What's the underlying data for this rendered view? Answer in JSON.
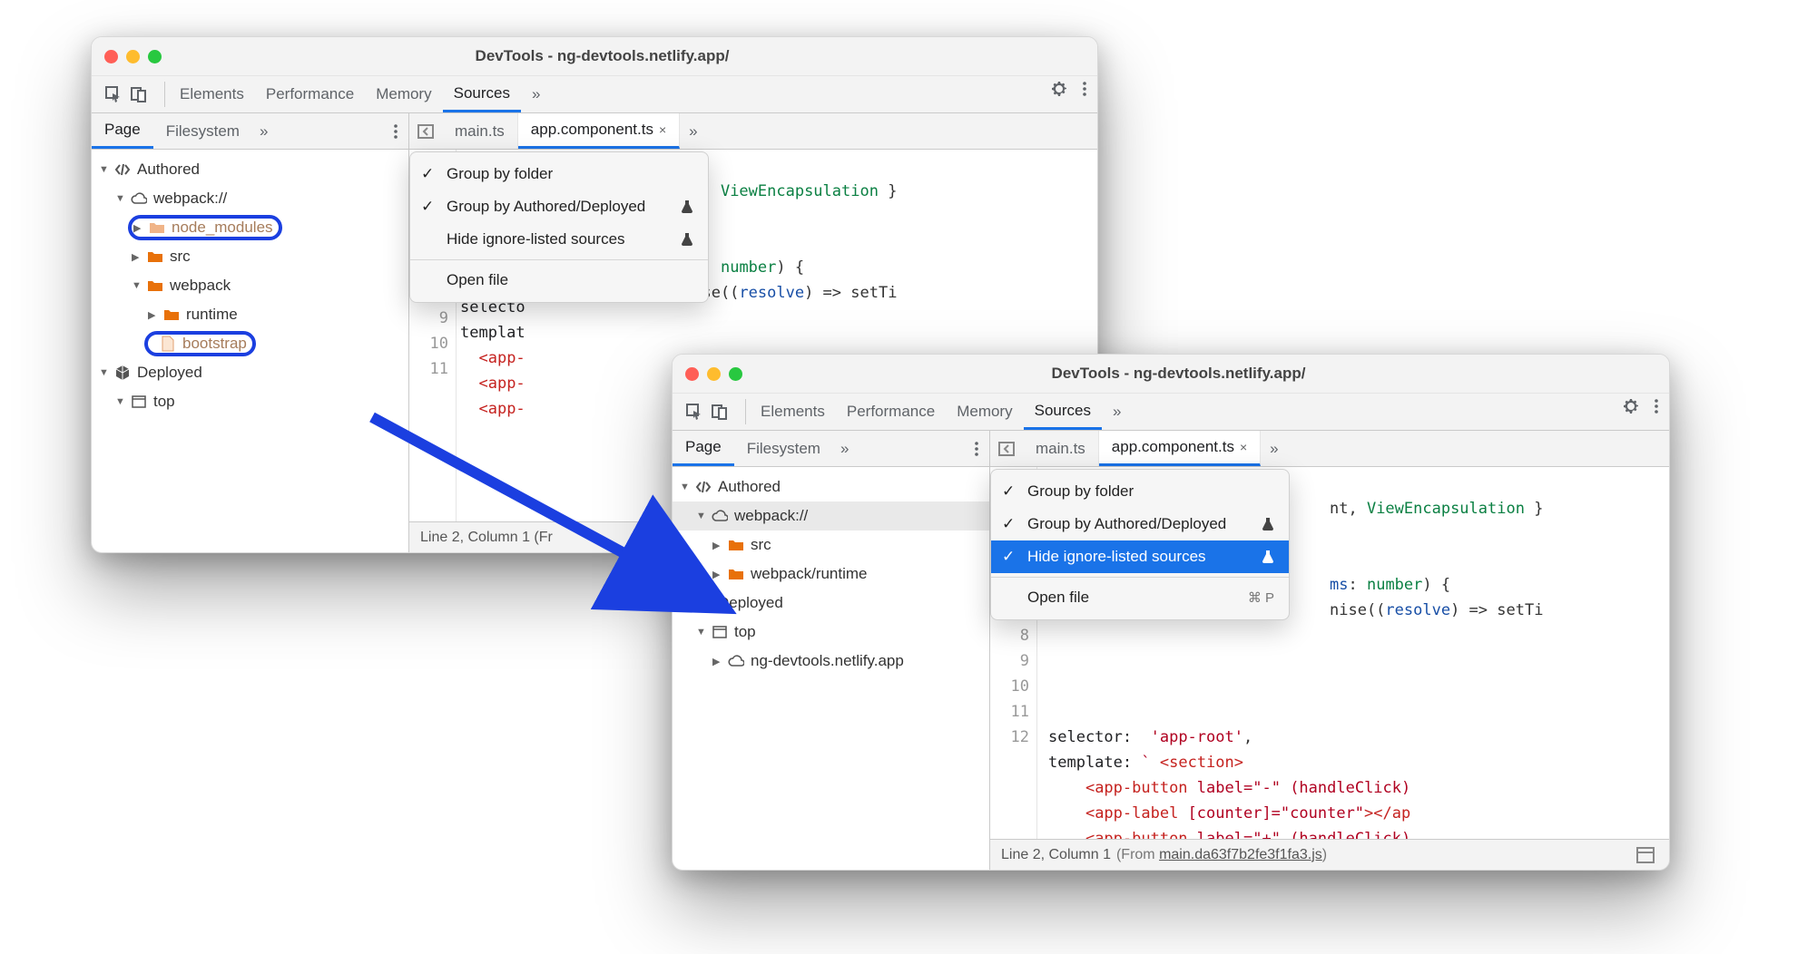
{
  "window_title": "DevTools - ng-devtools.netlify.app/",
  "toolbar": {
    "panels": [
      "Elements",
      "Performance",
      "Memory",
      "Sources"
    ],
    "active_panel": "Sources",
    "overflow": "»"
  },
  "subbar": {
    "nav_tabs": [
      "Page",
      "Filesystem"
    ],
    "active_nav": "Page",
    "nav_overflow": "»",
    "file_tabs": [
      {
        "label": "main.ts",
        "closeable": false
      },
      {
        "label": "app.component.ts",
        "closeable": true
      }
    ],
    "active_file_tab": "app.component.ts",
    "file_overflow": "»"
  },
  "tree_back": {
    "authored": "Authored",
    "webpack": "webpack://",
    "node_modules": "node_modules",
    "src": "src",
    "webpack_folder": "webpack",
    "runtime": "runtime",
    "bootstrap": "bootstrap",
    "deployed": "Deployed",
    "top": "top"
  },
  "tree_front": {
    "authored": "Authored",
    "webpack": "webpack://",
    "src": "src",
    "webpack_runtime": "webpack/runtime",
    "deployed": "Deployed",
    "top": "top",
    "site": "ng-devtools.netlify.app"
  },
  "menu": {
    "group_by_folder": "Group by folder",
    "group_by_authored": "Group by Authored/Deployed",
    "hide_ignored": "Hide ignore-listed sources",
    "open_file": "Open file",
    "open_file_kbd": "⌘ P"
  },
  "code": {
    "lines_numbers_back": [
      "8",
      "9",
      "10",
      "11"
    ],
    "frag_top_1": "nt, ",
    "frag_top_2": "ViewEncapsulation",
    "frag_top_3": " }",
    "frag_fn_1": "ms",
    "frag_fn_2": ": ",
    "frag_fn_3": "number",
    "frag_fn_4": ") {",
    "frag_pr_1": "nise((",
    "frag_pr_2": "resolve",
    "frag_pr_3": ") => setTi",
    "sel_line": "selector:  'app-root',",
    "tmpl_line_a": "template: ` ",
    "tmpl_line_b": "<section>",
    "l10": "    <app-button label=\"-\" (handleClick)",
    "l11": "    <app-label [counter]=\"counter\"></ap",
    "l12": "    <app-button label=\"+\" (handleClick)"
  },
  "code_front_ln": [
    "8",
    "9",
    "10",
    "11",
    "12"
  ],
  "code_back_partial": {
    "sel": "selecto",
    "tmpl": "templat",
    "app1": "<app-",
    "app2": "<app-",
    "app3": "<app-"
  },
  "status": {
    "pos": "Line 2, Column 1",
    "from_prefix": "(From ",
    "source_map": "main.da63f7b2fe3f1fa3.js",
    "from_suffix": ")",
    "pos_back": "Line 2, Column 1 (Fr"
  }
}
